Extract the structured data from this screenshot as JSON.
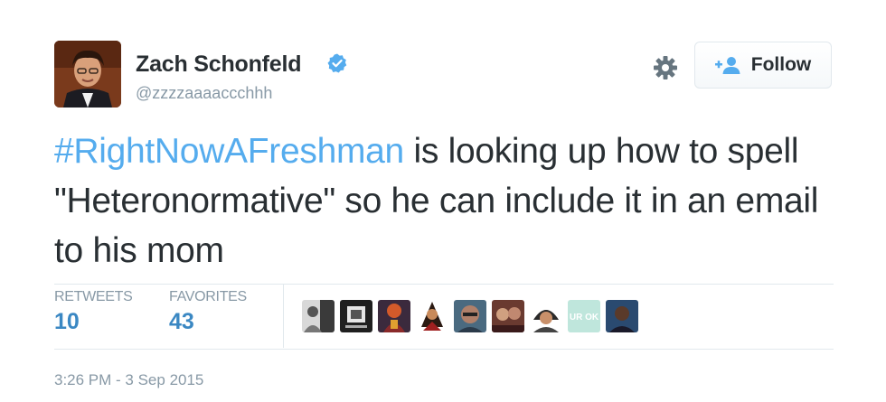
{
  "tweet": {
    "author": {
      "name": "Zach Schonfeld",
      "handle": "@zzzzaaaaccchhh",
      "verified": true,
      "avatar_icon": "user-avatar-photo"
    },
    "follow_label": "Follow",
    "text": {
      "hashtag": "#RightNowAFreshman",
      "body": " is looking up how to spell \"Heteronormative\" so he can include it in an email to his mom"
    },
    "stats": {
      "retweets_label": "RETWEETS",
      "retweets": "10",
      "favorites_label": "FAVORITES",
      "favorites": "43"
    },
    "favoriter_avatars": [
      {
        "icon": "favoriter-avatar-1"
      },
      {
        "icon": "favoriter-avatar-2"
      },
      {
        "icon": "favoriter-avatar-3"
      },
      {
        "icon": "favoriter-avatar-4"
      },
      {
        "icon": "favoriter-avatar-5"
      },
      {
        "icon": "favoriter-avatar-6"
      },
      {
        "icon": "favoriter-avatar-7"
      },
      {
        "icon": "favoriter-avatar-8",
        "text": "UR OK"
      },
      {
        "icon": "favoriter-avatar-9"
      }
    ],
    "timestamp": "3:26 PM - 3 Sep 2015"
  },
  "colors": {
    "hashtag": "#55acee",
    "stat_value": "#3b88c3",
    "verified": "#55acee",
    "muted": "#8899a6"
  }
}
